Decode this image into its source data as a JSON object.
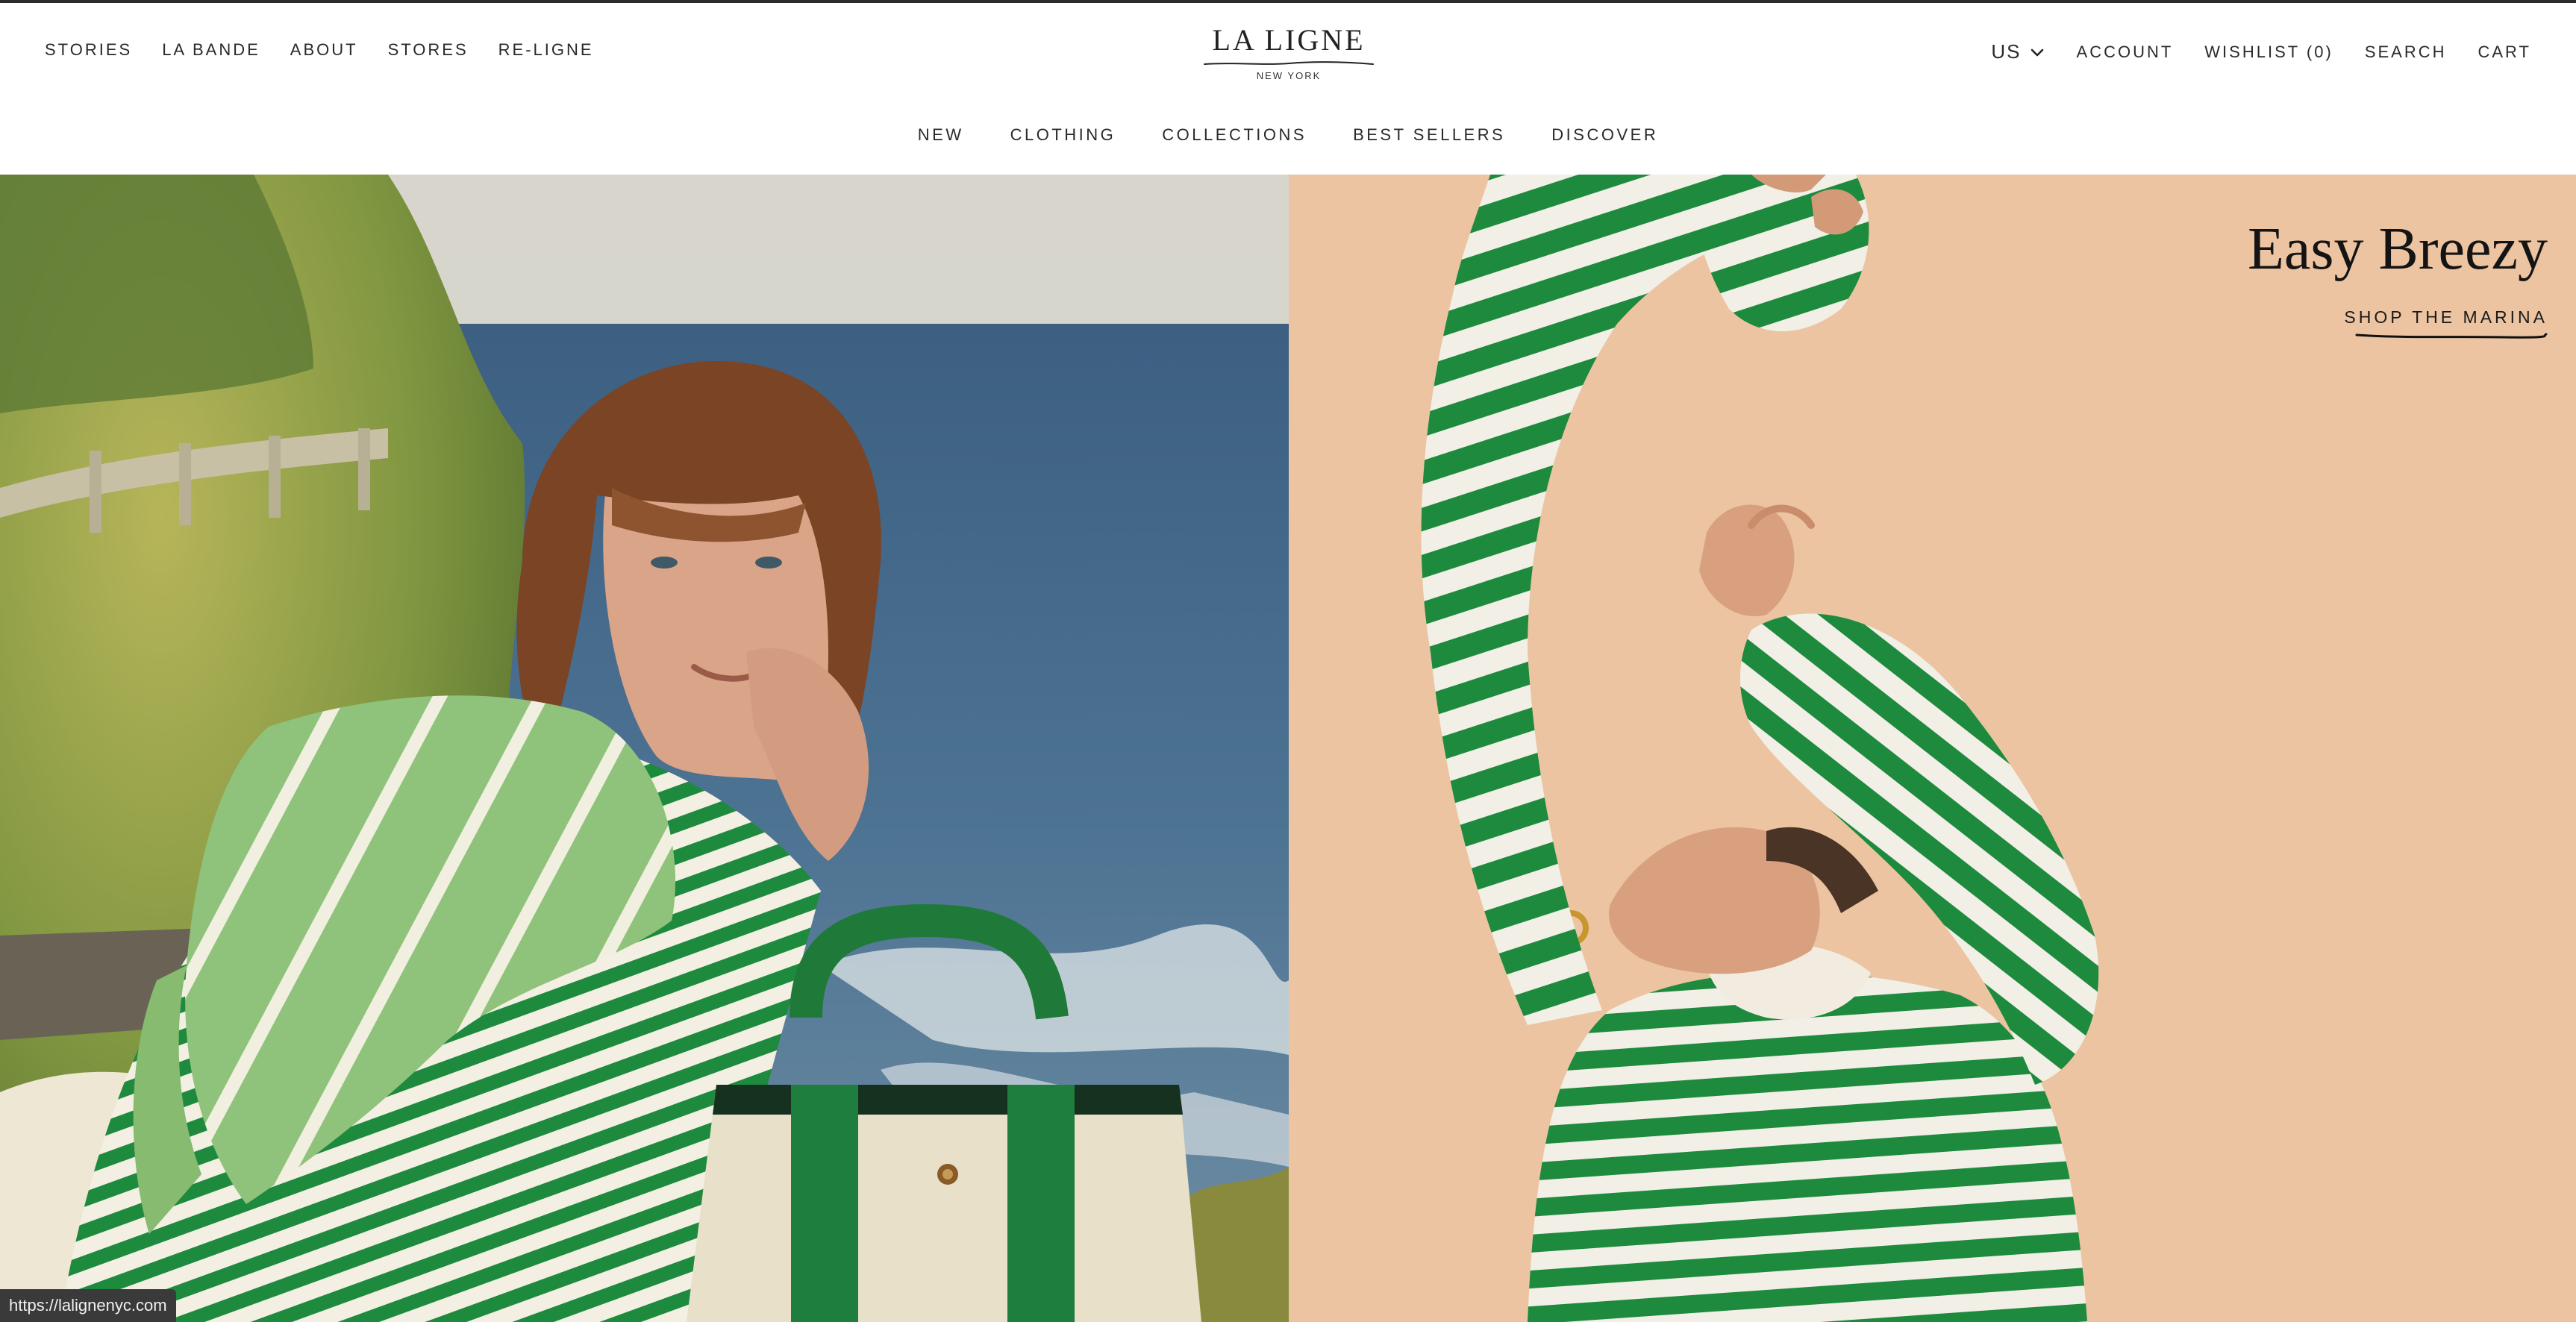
{
  "brand": {
    "name": "LA LIGNE",
    "subtitle": "NEW YORK"
  },
  "nav_left": [
    "STORIES",
    "LA BANDE",
    "ABOUT",
    "STORES",
    "RE-LIGNE"
  ],
  "nav_right": {
    "country": "US",
    "account": "ACCOUNT",
    "wishlist": "WISHLIST (0)",
    "search": "SEARCH",
    "cart": "CART"
  },
  "nav_main": [
    "NEW",
    "CLOTHING",
    "COLLECTIONS",
    "BEST SELLERS",
    "DISCOVER"
  ],
  "hero": {
    "right": {
      "title": "Easy Breezy",
      "cta": "SHOP THE MARINA"
    }
  },
  "status_bar": {
    "url": "https://lalignenyc.com"
  },
  "colors": {
    "sweater_green": "#1e8a3e",
    "sweater_white": "#f1efe6",
    "peach_background": "#efc8a6",
    "sea": "#4a6f8e",
    "foliage": "#8fa64a"
  },
  "icons": {
    "country_chevron": "chevron-down-icon"
  }
}
